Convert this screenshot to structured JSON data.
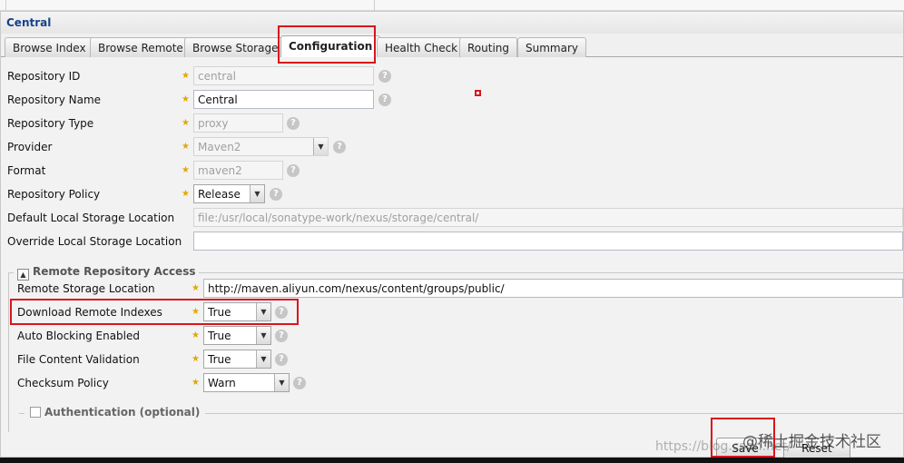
{
  "panel": {
    "title": "Central"
  },
  "tabs": [
    {
      "label": "Browse Index"
    },
    {
      "label": "Browse Remote"
    },
    {
      "label": "Browse Storage"
    },
    {
      "label": "Configuration",
      "active": true
    },
    {
      "label": "Health Check"
    },
    {
      "label": "Routing"
    },
    {
      "label": "Summary"
    }
  ],
  "form": {
    "repository_id": {
      "label": "Repository ID",
      "value": "central"
    },
    "repository_name": {
      "label": "Repository Name",
      "value": "Central"
    },
    "repository_type": {
      "label": "Repository Type",
      "value": "proxy"
    },
    "provider": {
      "label": "Provider",
      "value": "Maven2"
    },
    "format": {
      "label": "Format",
      "value": "maven2"
    },
    "repository_policy": {
      "label": "Repository Policy",
      "value": "Release"
    },
    "default_storage": {
      "label": "Default Local Storage Location",
      "value": "file:/usr/local/sonatype-work/nexus/storage/central/"
    },
    "override_storage": {
      "label": "Override Local Storage Location",
      "value": ""
    }
  },
  "remote": {
    "legend": "Remote Repository Access",
    "remote_location": {
      "label": "Remote Storage Location",
      "value": "http://maven.aliyun.com/nexus/content/groups/public/"
    },
    "download_indexes": {
      "label": "Download Remote Indexes",
      "value": "True"
    },
    "auto_blocking": {
      "label": "Auto Blocking Enabled",
      "value": "True"
    },
    "file_validation": {
      "label": "File Content Validation",
      "value": "True"
    },
    "checksum_policy": {
      "label": "Checksum Policy",
      "value": "Warn"
    },
    "authentication": {
      "legend": "Authentication (optional)"
    }
  },
  "buttons": {
    "save": "Save",
    "reset": "Reset"
  },
  "watermark": {
    "url": "https://blog.csdn.net/",
    "brand": "@稀土掘金技术社区"
  },
  "icons": {
    "required": "star-icon",
    "help": "help-icon",
    "dropdown": "chevron-down-icon",
    "collapse": "collapse-toggle-icon"
  },
  "colors": {
    "highlight": "#d9141c",
    "required": "#e2a700",
    "title": "#15428b"
  }
}
